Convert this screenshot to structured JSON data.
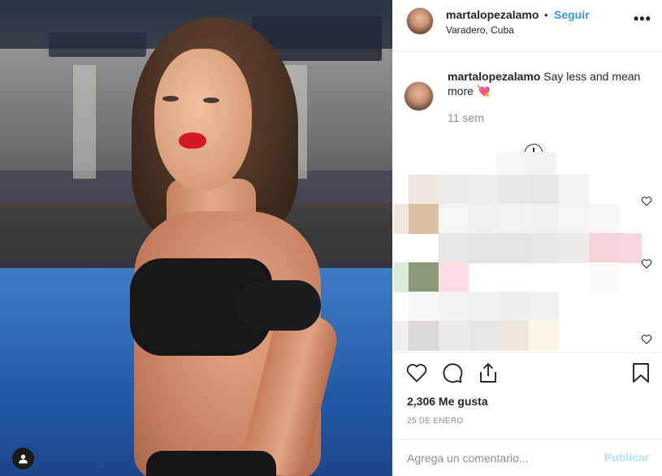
{
  "post": {
    "username": "martalopezalamo",
    "dot": "•",
    "follow_label": "Seguir",
    "location": "Varadero, Cuba",
    "more_icon": "more-options-icon",
    "more_glyph": "•••"
  },
  "caption": {
    "username": "martalopezalamo",
    "text": "Say less and mean more",
    "emoji": "💘",
    "time": "11 sem"
  },
  "actions": {
    "likes": "2,306 Me gusta",
    "date": "25 DE ENERO",
    "icons": [
      "heart-icon",
      "comment-icon",
      "share-icon",
      "bookmark-icon"
    ]
  },
  "comment": {
    "placeholder": "Agrega un comentario...",
    "publish_label": "Publicar"
  },
  "colors": {
    "link": "#3897f0",
    "publish_disabled": "#b2dffc",
    "muted": "#8e8e8e",
    "text": "#262626"
  }
}
